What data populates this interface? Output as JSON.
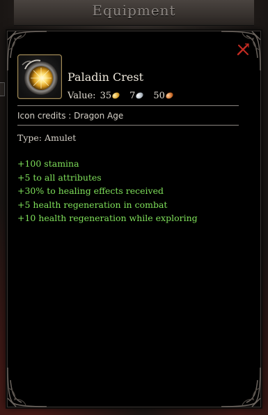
{
  "window": {
    "title": "Equipment"
  },
  "tooltip": {
    "item_name": "Paladin Crest",
    "icon": "amulet-icon",
    "value": {
      "label": "Value:",
      "gold": "35",
      "silver": "7",
      "copper": "50"
    },
    "icon_credits": "Icon credits : Dragon Age",
    "type_line": "Type: Amulet",
    "stats": [
      "+100 stamina",
      "+5 to all attributes",
      "+30% to healing effects received",
      "+5 health regeneration in combat",
      "+10 health regeneration while exploring"
    ],
    "close_icon": "close-icon"
  },
  "colors": {
    "stat_text": "#7fe05a",
    "frame_gold": "#a58f5a",
    "close_red": "#c22b22"
  }
}
